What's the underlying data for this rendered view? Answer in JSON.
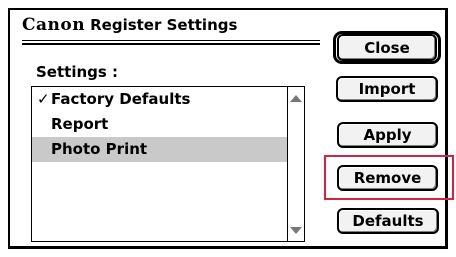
{
  "dialog": {
    "brand": "Canon",
    "title": "Register Settings",
    "settings_label": "Settings :"
  },
  "settings_list": {
    "items": [
      {
        "label": "Factory Defaults",
        "checked": "✓",
        "state": "checked"
      },
      {
        "label": "Report",
        "checked": "",
        "state": "normal"
      },
      {
        "label": "Photo Print",
        "checked": "",
        "state": "selected"
      }
    ]
  },
  "buttons": {
    "close": "Close",
    "import": "Import",
    "apply": "Apply",
    "remove": "Remove",
    "defaults": "Defaults"
  },
  "colors": {
    "highlight": "#d6243f",
    "selection": "#c9c9c9"
  }
}
